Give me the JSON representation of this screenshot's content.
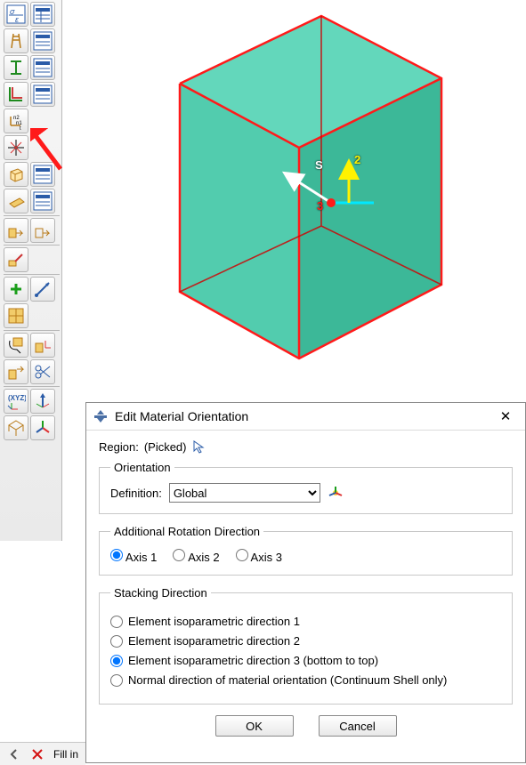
{
  "toolbar": {
    "rows": [
      [
        "sigma-epsilon-icon",
        "sigma-table-icon"
      ],
      [
        "tower-icon",
        "tower-table-icon"
      ],
      [
        "ibeam-icon",
        "ibeam-table-icon"
      ],
      [
        "profile-icon",
        "profile-table-icon"
      ],
      [
        "csys-n1n2-icon",
        "-"
      ],
      [
        "crosshair-icon",
        "-"
      ],
      [
        "cube-icon",
        "cube-table-icon"
      ],
      [
        "plane-icon",
        "plane-table-icon"
      ],
      "hr",
      [
        "assign-a-icon",
        "assign-b-icon"
      ],
      "hr",
      [
        "brush-icon",
        "-"
      ],
      "hr",
      [
        "plus-icon",
        "vector-blue-icon"
      ],
      [
        "mesh-icon",
        "-"
      ],
      "hr",
      [
        "lasso-icon",
        "pick-csys-icon"
      ],
      [
        "pick-a-icon",
        "scissors-icon"
      ],
      "hr",
      [
        "xyz-icon",
        "triad-up-icon"
      ],
      [
        "iso-icon",
        "triad-star-icon"
      ]
    ]
  },
  "status": {
    "fill_label": "Fill in"
  },
  "viewport": {
    "csys_labels": {
      "s": "S",
      "two": "2",
      "three": "3"
    }
  },
  "dialog": {
    "title": "Edit Material Orientation",
    "region_label": "Region:",
    "region_value": "(Picked)",
    "orient_legend": "Orientation",
    "definition_label": "Definition:",
    "definition_options": [
      "Global"
    ],
    "definition_selected": "Global",
    "addrot_legend": "Additional Rotation Direction",
    "axis_options": [
      "Axis 1",
      "Axis 2",
      "Axis 3"
    ],
    "axis_selected": "Axis 1",
    "stack_legend": "Stacking Direction",
    "stack_options": [
      "Element isoparametric direction 1",
      "Element isoparametric direction 2",
      "Element isoparametric direction 3 (bottom to top)",
      "Normal direction of material orientation (Continuum Shell only)"
    ],
    "stack_selected": "Element isoparametric direction 3 (bottom to top)",
    "ok_label": "OK",
    "cancel_label": "Cancel"
  }
}
